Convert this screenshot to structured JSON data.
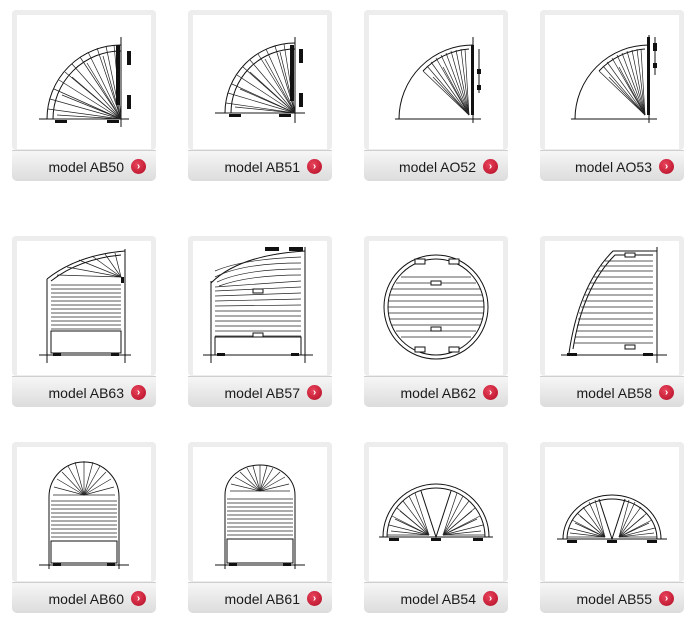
{
  "models": [
    {
      "label": "model AB50",
      "shape": "quarter-dense"
    },
    {
      "label": "model AB51",
      "shape": "quarter-dense"
    },
    {
      "label": "model AO52",
      "shape": "quarter-open"
    },
    {
      "label": "model AO53",
      "shape": "quarter-open"
    },
    {
      "label": "model AB63",
      "shape": "rect-arch-corner"
    },
    {
      "label": "model AB57",
      "shape": "rect-curve-top"
    },
    {
      "label": "model AB62",
      "shape": "circle"
    },
    {
      "label": "model AB58",
      "shape": "rect-slope"
    },
    {
      "label": "model AB60",
      "shape": "arch-top"
    },
    {
      "label": "model AB61",
      "shape": "arch-top"
    },
    {
      "label": "model AB54",
      "shape": "half-fan"
    },
    {
      "label": "model AB55",
      "shape": "half-fan"
    }
  ],
  "icons": {
    "link_arrow": "chevron-right-icon",
    "accent": "#c8102e"
  }
}
